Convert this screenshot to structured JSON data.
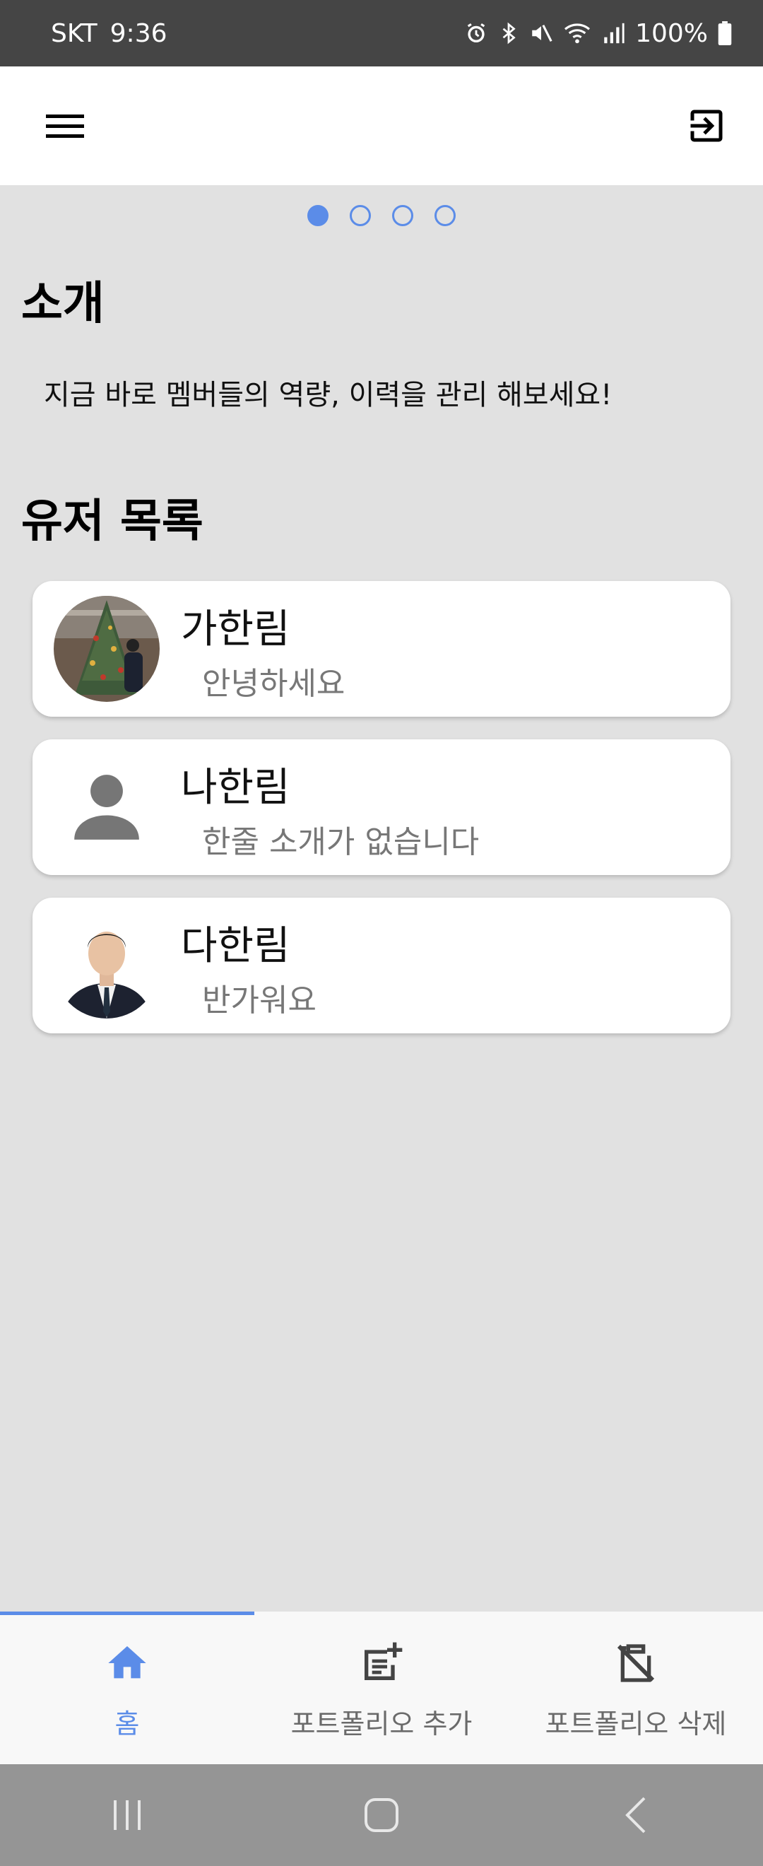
{
  "status_bar": {
    "carrier": "SKT",
    "time": "9:36",
    "battery": "100%",
    "icons": [
      "alarm-icon",
      "bluetooth-icon",
      "mute-icon",
      "wifi-icon",
      "signal-icon",
      "battery-icon"
    ]
  },
  "app_bar": {
    "menu_icon": "hamburger-menu-icon",
    "logout_icon": "exit-icon"
  },
  "pager": {
    "count": 4,
    "active_index": 0
  },
  "intro": {
    "title": "소개",
    "text": "지금 바로 멤버들의 역량, 이력을 관리 해보세요!"
  },
  "users": {
    "title": "유저 목록",
    "items": [
      {
        "name": "가한림",
        "bio": "안녕하세요",
        "avatar": "photo-christmas-tree"
      },
      {
        "name": "나한림",
        "bio": "한줄 소개가 없습니다",
        "avatar": "default-person-icon"
      },
      {
        "name": "다한림",
        "bio": "반가워요",
        "avatar": "photo-portrait-suit"
      }
    ]
  },
  "bottom_nav": {
    "items": [
      {
        "label": "홈",
        "icon": "home-icon",
        "active": true
      },
      {
        "label": "포트폴리오 추가",
        "icon": "note-add-icon",
        "active": false
      },
      {
        "label": "포트폴리오 삭제",
        "icon": "clipboard-off-icon",
        "active": false
      }
    ]
  },
  "colors": {
    "accent": "#5b8ce8",
    "background": "#e1e1e1",
    "status_bar": "#454545",
    "system_nav": "#959595"
  }
}
